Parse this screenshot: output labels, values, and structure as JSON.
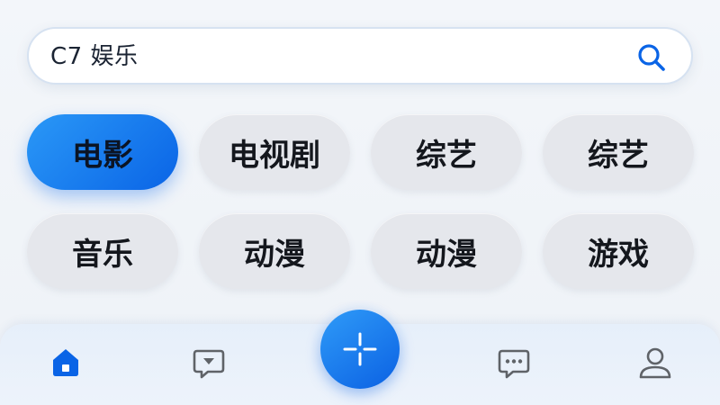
{
  "search": {
    "value": "C7 娱乐"
  },
  "categories": [
    {
      "label": "电影",
      "active": true
    },
    {
      "label": "电视剧",
      "active": false
    },
    {
      "label": "综艺",
      "active": false
    },
    {
      "label": "综艺",
      "active": false
    },
    {
      "label": "音乐",
      "active": false
    },
    {
      "label": "动漫",
      "active": false
    },
    {
      "label": "动漫",
      "active": false
    },
    {
      "label": "游戏",
      "active": false
    }
  ],
  "bottom_nav": {
    "items": [
      {
        "icon": "home-icon",
        "active": true
      },
      {
        "icon": "message-download-icon",
        "active": false
      },
      {
        "icon": "add-icon",
        "active": false
      },
      {
        "icon": "chat-icon",
        "active": false
      },
      {
        "icon": "profile-icon",
        "active": false
      }
    ]
  },
  "colors": {
    "accent": "#0a64e6",
    "chip_bg": "#e5e7ec",
    "icon_gray": "#5f6368"
  }
}
